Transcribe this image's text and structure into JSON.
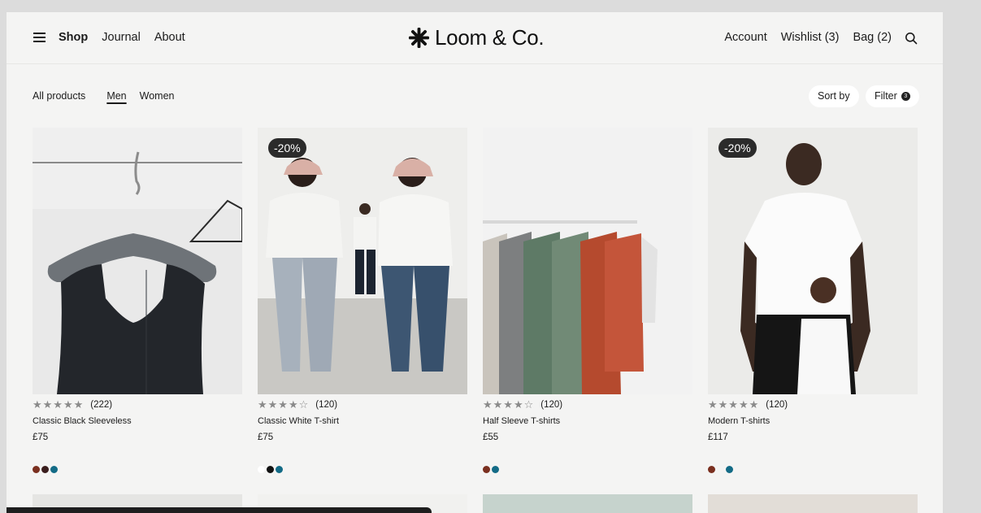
{
  "nav": {
    "left": [
      {
        "label": "Shop",
        "active": true
      },
      {
        "label": "Journal",
        "active": false
      },
      {
        "label": "About",
        "active": false
      }
    ],
    "brand": "Loom & Co.",
    "right": {
      "account": "Account",
      "wishlist": "Wishlist (3)",
      "bag": "Bag (2)"
    }
  },
  "filters": {
    "categories": [
      "All products",
      "Men",
      "Women"
    ],
    "selected": "Men",
    "sort_label": "Sort by",
    "filter_label": "Filter",
    "filter_count": "3"
  },
  "products": [
    {
      "name": "Classic Black Sleeveless",
      "price": "£75",
      "stars": "★★★★★",
      "reviews": "(222)",
      "badge": "",
      "swatches": [
        "#7a2f1f",
        "#3a1d1d",
        "#136b86"
      ]
    },
    {
      "name": "Classic White T-shirt",
      "price": "£75",
      "stars": "★★★★☆",
      "reviews": "(120)",
      "badge": "-20%",
      "swatches": [
        "#ffffff",
        "#111111",
        "#136b86"
      ]
    },
    {
      "name": "Half Sleeve T-shirts",
      "price": "£55",
      "stars": "★★★★☆",
      "reviews": "(120)",
      "badge": "",
      "swatches": [
        "#7a2f1f",
        "#136b86"
      ]
    },
    {
      "name": "Modern T-shirts",
      "price": "£117",
      "stars": "★★★★★",
      "reviews": "(120)",
      "badge": "-20%",
      "swatches": [
        "#7a2f1f",
        "#f4f4f3",
        "#136b86"
      ]
    }
  ],
  "colors": {
    "background": "#f4f4f3",
    "badge": "#2b2b2b",
    "star": "#8a8a8a"
  }
}
